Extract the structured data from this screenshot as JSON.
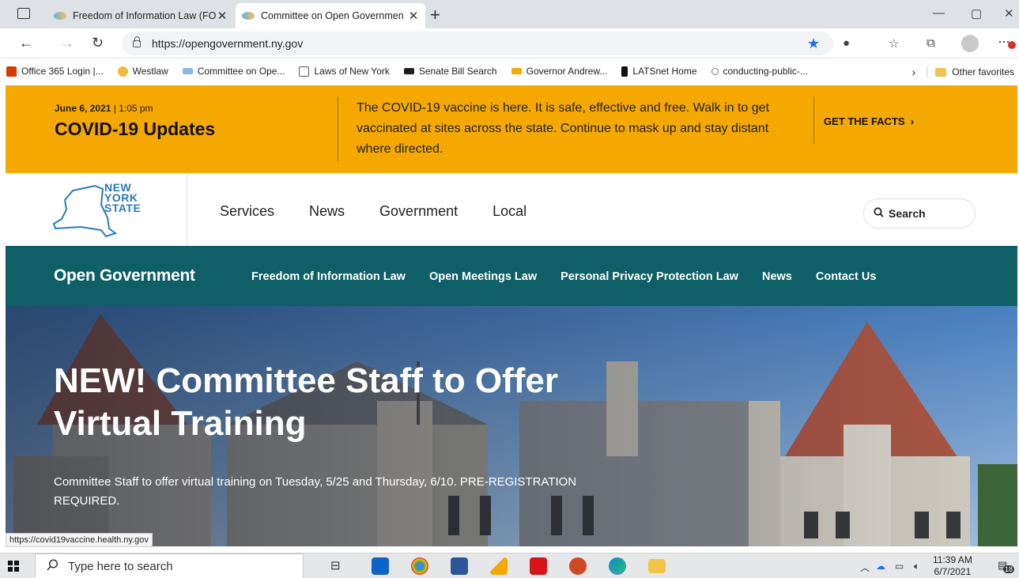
{
  "browser": {
    "tabs": [
      {
        "title": "Freedom of Information Law (FO"
      },
      {
        "title": "Committee on Open Governmen"
      }
    ],
    "url": "https://opengovernment.ny.gov",
    "favorites": [
      {
        "label": "Office 365 Login |...",
        "color": "#d83b01"
      },
      {
        "label": "Westlaw",
        "color": "#f4b73f"
      },
      {
        "label": "Committee on Ope...",
        "color": "#8cb8e4"
      },
      {
        "label": "Laws of New York",
        "color": "#ffffff"
      },
      {
        "label": "Senate Bill Search",
        "color": "#1f1f1f"
      },
      {
        "label": "Governor Andrew...",
        "color": "#f5a800"
      },
      {
        "label": "LATSnet Home",
        "color": "#111111"
      },
      {
        "label": "conducting-public-...",
        "color": "#ffffff"
      }
    ],
    "other_favorites": "Other favorites",
    "status_url": "https://covid19vaccine.health.ny.gov"
  },
  "covid_banner": {
    "date": "June 6, 2021",
    "time": "1:05 pm",
    "heading": "COVID-19 Updates",
    "message": "The COVID-19 vaccine is here. It is safe, effective and free. Walk in to get vaccinated at sites across the state. Continue to mask up and stay distant where directed.",
    "cta": "GET THE FACTS"
  },
  "nys_header": {
    "logo_lines": [
      "NEW",
      "YORK",
      "STATE"
    ],
    "nav": [
      "Services",
      "News",
      "Government",
      "Local"
    ],
    "search_label": "Search"
  },
  "og_nav": {
    "brand": "Open Government",
    "links": [
      "Freedom of Information Law",
      "Open Meetings Law",
      "Personal Privacy Protection Law",
      "News",
      "Contact Us"
    ]
  },
  "hero": {
    "title": "NEW! Committee Staff to Offer Virtual Training",
    "description": "Committee Staff to offer virtual training on Tuesday, 5/25 and Thursday, 6/10. PRE-REGISTRATION REQUIRED."
  },
  "taskbar": {
    "search_placeholder": "Type here to search",
    "time": "11:39 AM",
    "date": "6/7/2021",
    "notification_count": "18"
  }
}
